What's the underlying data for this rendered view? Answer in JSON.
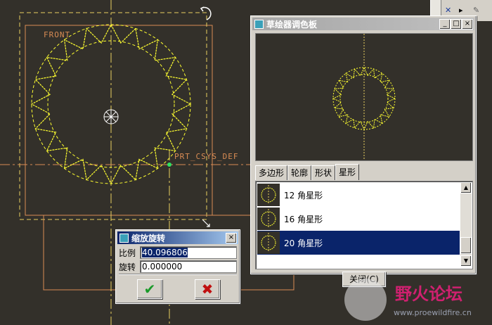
{
  "canvas": {
    "labels": {
      "front": "FRONT",
      "csys": "PRT_CSYS_DEF"
    },
    "colors": {
      "background": "#33302a",
      "geometry": "#ffff30",
      "datum": "#d98c54",
      "centerline": "#e8d060"
    }
  },
  "toolbar": {
    "icons": [
      "select-arrow-icon",
      "sketch-pen-icon"
    ]
  },
  "palette": {
    "title": "草绘器调色板",
    "title_buttons": [
      "_",
      "□",
      "×"
    ],
    "tabs": [
      {
        "label": "多边形",
        "selected": false
      },
      {
        "label": "轮廓",
        "selected": false
      },
      {
        "label": "形状",
        "selected": false
      },
      {
        "label": "星形",
        "selected": true
      }
    ],
    "items": [
      {
        "label": "12 角星形",
        "selected": false
      },
      {
        "label": "16 角星形",
        "selected": false
      },
      {
        "label": "20 角星形",
        "selected": true
      }
    ],
    "close_label": "关闭(C)"
  },
  "scale_dialog": {
    "title": "缩放旋转",
    "scale_label": "比例",
    "scale_value": "40.096806",
    "rotate_label": "旋转",
    "rotate_value": "0.000000",
    "ok_icon": "checkmark-icon",
    "cancel_icon": "cross-icon"
  },
  "watermark": {
    "brand": "野火论坛",
    "url": "www.proewildfire.cn"
  }
}
